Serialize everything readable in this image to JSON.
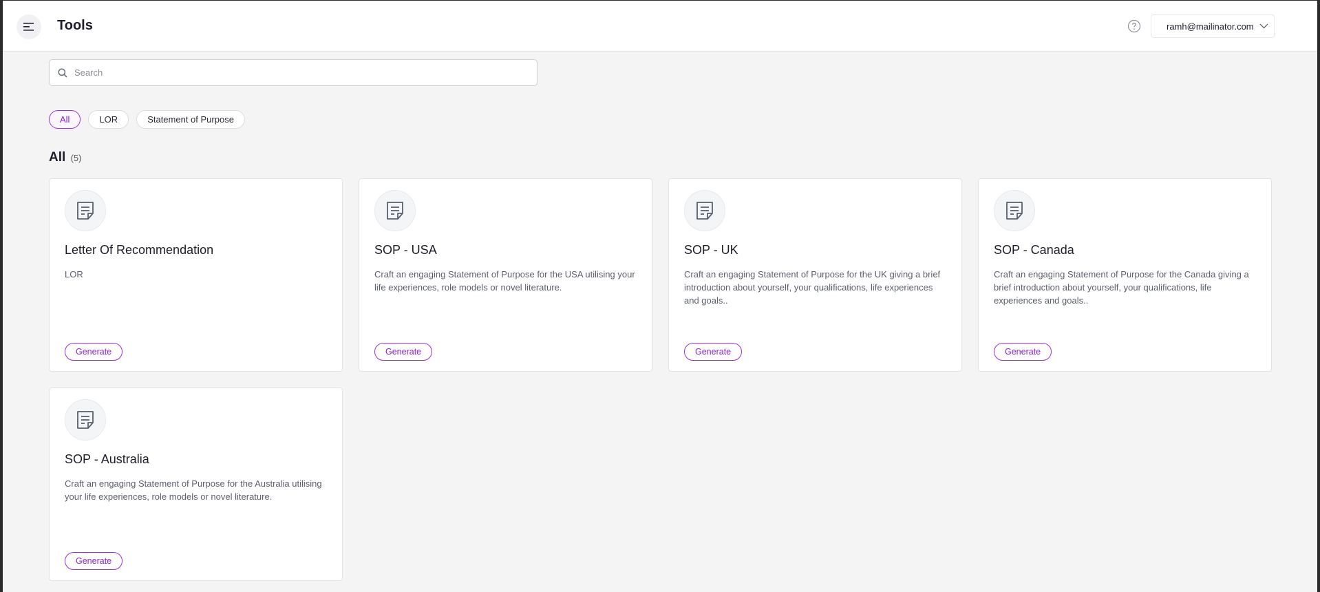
{
  "header": {
    "title": "Tools",
    "user_email": "ramh@mailinator.com"
  },
  "search": {
    "placeholder": "Search",
    "value": ""
  },
  "filters": [
    {
      "label": "All",
      "active": true
    },
    {
      "label": "LOR",
      "active": false
    },
    {
      "label": "Statement of Purpose",
      "active": false
    }
  ],
  "section": {
    "title": "All",
    "count": "(5)"
  },
  "cards": [
    {
      "title": "Letter Of Recommendation",
      "description": "LOR",
      "button": "Generate",
      "icon": "document-icon"
    },
    {
      "title": "SOP - USA",
      "description": "Craft an engaging Statement of Purpose for the USA utilising your life experiences, role models or novel literature.",
      "button": "Generate",
      "icon": "document-icon"
    },
    {
      "title": "SOP - UK",
      "description": "Craft an engaging Statement of Purpose for the UK giving a brief introduction about yourself, your qualifications, life experiences and goals..",
      "button": "Generate",
      "icon": "document-icon"
    },
    {
      "title": "SOP - Canada",
      "description": "Craft an engaging Statement of Purpose for the Canada giving a brief introduction about yourself, your qualifications, life experiences and goals..",
      "button": "Generate",
      "icon": "document-icon"
    },
    {
      "title": "SOP - Australia",
      "description": "Craft an engaging Statement of Purpose for the Australia utilising your life experiences, role models or novel literature.",
      "button": "Generate",
      "icon": "document-icon"
    }
  ],
  "colors": {
    "accent": "#9b2fe0",
    "background": "#f4f4f4"
  }
}
